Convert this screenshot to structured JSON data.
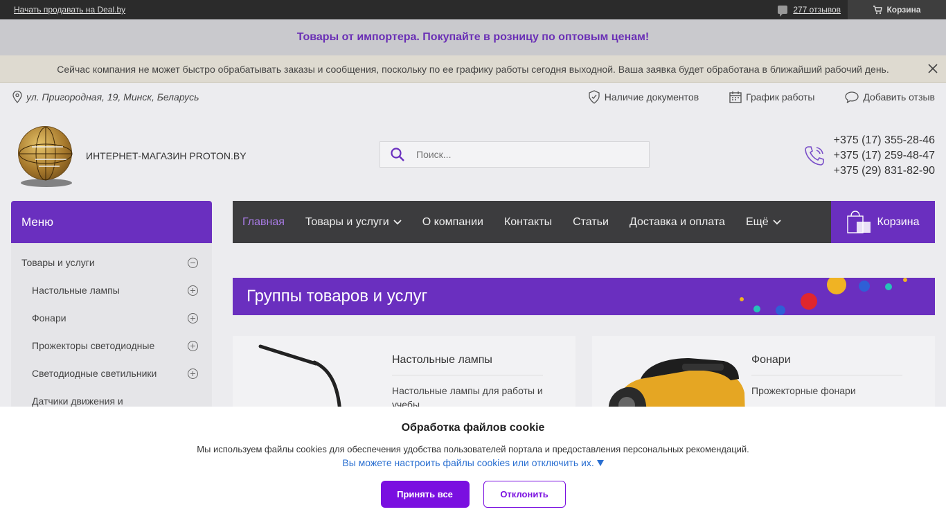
{
  "topbar": {
    "sell_link": "Начать продавать на Deal.by",
    "reviews_link": "277 отзывов",
    "cart_label": "Корзина"
  },
  "promo": {
    "text": "Товары от импортера. Покупайте в розницу по оптовым ценам!"
  },
  "notice": {
    "text": "Сейчас компания не может быстро обрабатывать заказы и сообщения, поскольку по ее графику работы сегодня выходной. Ваша заявка будет обработана в ближайший рабочий день."
  },
  "infobar": {
    "address": "ул. Пригородная, 19, Минск, Беларусь",
    "documents": "Наличие документов",
    "schedule": "График работы",
    "add_review": "Добавить отзыв"
  },
  "header": {
    "logo_text": "ИНТЕРНЕТ-МАГАЗИН PROTON.BY",
    "search_placeholder": "Поиск...",
    "phones": [
      "+375 (17) 355-28-46",
      "+375 (17) 259-48-47",
      "+375 (29) 831-82-90"
    ]
  },
  "sidebar": {
    "title": "Меню",
    "items": [
      {
        "label": "Товары и услуги"
      },
      {
        "label": "Настольные лампы"
      },
      {
        "label": "Фонари"
      },
      {
        "label": "Прожекторы светодиодные"
      },
      {
        "label": "Светодиодные светильники"
      },
      {
        "label": "Датчики движения и"
      }
    ]
  },
  "nav": {
    "items": [
      "Главная",
      "Товары и услуги",
      "О компании",
      "Контакты",
      "Статьи",
      "Доставка и оплата",
      "Ещё"
    ],
    "cart": "Корзина"
  },
  "groups": {
    "title": "Группы товаров и услуг",
    "cards": [
      {
        "title": "Настольные лампы",
        "link": "Настольные лампы для работы и учебы"
      },
      {
        "title": "Фонари",
        "link": "Прожекторные фонари"
      }
    ]
  },
  "cookie": {
    "title": "Обработка файлов cookie",
    "text": "Мы используем файлы cookies для обеспечения удобства пользователей портала и предоставления персональных рекомендаций.",
    "link": "Вы можете настроить файлы cookies или отключить их.",
    "accept": "Принять все",
    "decline": "Отклонить"
  },
  "colors": {
    "accent": "#6a2fbf",
    "button": "#7a0fe0",
    "link": "#2a6fd1"
  }
}
